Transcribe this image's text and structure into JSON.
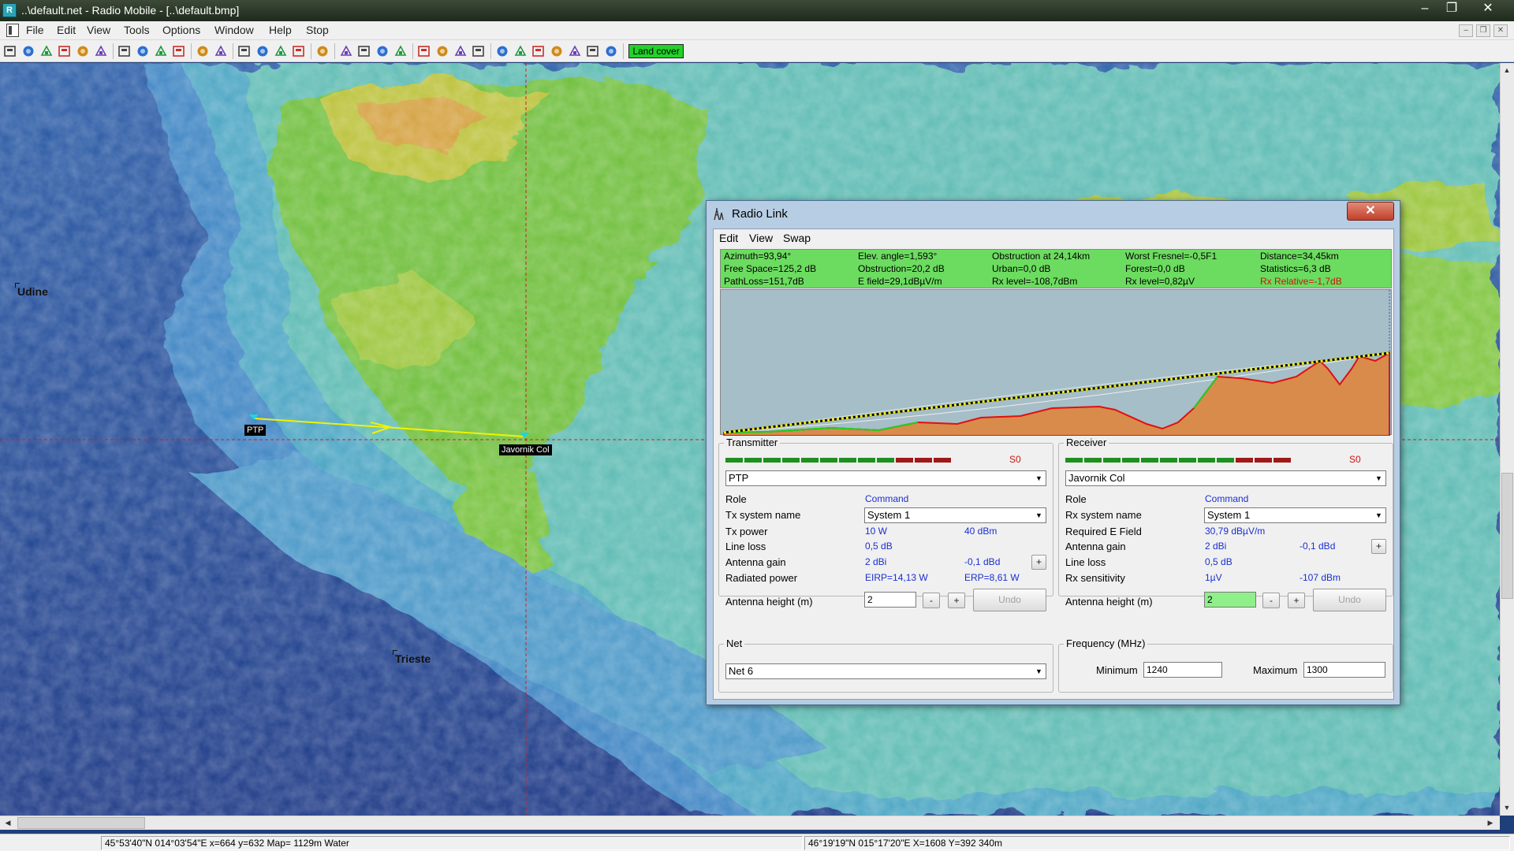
{
  "window": {
    "app_icon": "R",
    "title": "..\\default.net - Radio Mobile - [..\\default.bmp]",
    "controls": {
      "minimize": "–",
      "restore": "❐",
      "close": "✕"
    }
  },
  "menu": {
    "items": [
      "File",
      "Edit",
      "View",
      "Tools",
      "Options",
      "Window",
      "Help",
      "Stop"
    ],
    "mdi": {
      "minimize": "–",
      "restore": "❐",
      "close": "✕"
    }
  },
  "toolbar": {
    "land_cover_label": "Land cover",
    "icons": [
      "new-icon",
      "open-icon",
      "save-all-icon",
      "close-icon",
      "cross-icon",
      "cross-red-icon",
      "globe-icon",
      "globe-dark-icon",
      "globe-red-icon",
      "arrow-left-icon",
      "arrow-right-icon",
      "page-icon",
      "page-edit-icon",
      "disk-icon",
      "delete-icon",
      "print-icon",
      "copy-icon",
      "paste-icon",
      "image-icon",
      "grid-icon",
      "ruler-icon",
      "scale-icon",
      "window-icon",
      "user-icon",
      "frame-icon",
      "radio-link-icon",
      "coverage-green-icon",
      "coverage-yellow-icon",
      "coverage-pink-icon",
      "route-icon",
      "export-icon",
      "earth-icon"
    ]
  },
  "map": {
    "cities": [
      {
        "name": "Udine"
      },
      {
        "name": "Trieste"
      }
    ],
    "sites": [
      {
        "name": "PTP"
      },
      {
        "name": "Javornik Col"
      }
    ],
    "colors": {
      "sea": "#1f3f8c",
      "low": "#3b7fc0",
      "mid": "#53b6b8",
      "green": "#6fbf3c",
      "hill": "#b7c33a",
      "peak": "#d19b3e",
      "link": "#f2f200",
      "cursor": "#c82020"
    }
  },
  "status": {
    "left": "45°53'40\"N 014°03'54\"E  x=664 y=632 Map= 1129m Water",
    "right": "46°19'19\"N 015°17'20\"E  X=1608 Y=392 340m"
  },
  "radio_link": {
    "title": "Radio Link",
    "close_glyph": "✕",
    "menu": [
      "Edit",
      "View",
      "Swap"
    ],
    "info": [
      [
        "Azimuth=93,94°",
        "Elev. angle=1,593°",
        "Obstruction at 24,14km",
        "Worst Fresnel=-0,5F1",
        "Distance=34,45km"
      ],
      [
        "Free Space=125,2 dB",
        "Obstruction=20,2 dB",
        "Urban=0,0 dB",
        "Forest=0,0 dB",
        "Statistics=6,3 dB"
      ],
      [
        "PathLoss=151,7dB",
        "E field=29,1dBµV/m",
        "Rx level=-108,7dBm",
        "Rx level=0,82µV",
        "Rx Relative=-1,7dB"
      ]
    ],
    "rx_relative_color": "#d01010",
    "transmitter": {
      "group_title": "Transmitter",
      "signal": "S0",
      "unit": "PTP",
      "role_label": "Role",
      "role": "Command",
      "system_label": "Tx system name",
      "system": "System  1",
      "power_label": "Tx power",
      "power_w": "10 W",
      "power_dbm": "40 dBm",
      "loss_label": "Line loss",
      "loss": "0,5 dB",
      "gain_label": "Antenna gain",
      "gain_dbi": "2 dBi",
      "gain_dbd": "-0,1 dBd",
      "radiated_label": "Radiated power",
      "eirp": "EIRP=14,13 W",
      "erp": "ERP=8,61 W",
      "height_label": "Antenna height (m)",
      "height": "2",
      "minus": "-",
      "plus": "+",
      "undo": "Undo"
    },
    "receiver": {
      "group_title": "Receiver",
      "signal": "S0",
      "unit": "Javornik Col",
      "role_label": "Role",
      "role": "Command",
      "system_label": "Rx system name",
      "system": "System  1",
      "efield_label": "Required E Field",
      "efield": "30,79 dBµV/m",
      "gain_label": "Antenna gain",
      "gain_dbi": "2 dBi",
      "gain_dbd": "-0,1 dBd",
      "loss_label": "Line loss",
      "loss": "0,5 dB",
      "sens_label": "Rx sensitivity",
      "sens_uv": "1µV",
      "sens_dbm": "-107 dBm",
      "height_label": "Antenna height (m)",
      "height": "2",
      "minus": "-",
      "plus": "+",
      "undo": "Undo"
    },
    "net": {
      "group_title": "Net",
      "value": "Net 6"
    },
    "frequency": {
      "group_title": "Frequency (MHz)",
      "min_label": "Minimum",
      "min": "1240",
      "max_label": "Maximum",
      "max": "1300"
    },
    "meter": {
      "segments": 12,
      "green": 9,
      "red": 3,
      "green_color": "#1f8f1f",
      "red_color": "#a01818"
    },
    "profile_colors": {
      "sky": "#a6bec7",
      "terrain": "#d98b4c",
      "terrain_line": "#e01010",
      "clear_line": "#20d020",
      "beam": "#f2f200",
      "fresnel": "#ffffff"
    }
  }
}
